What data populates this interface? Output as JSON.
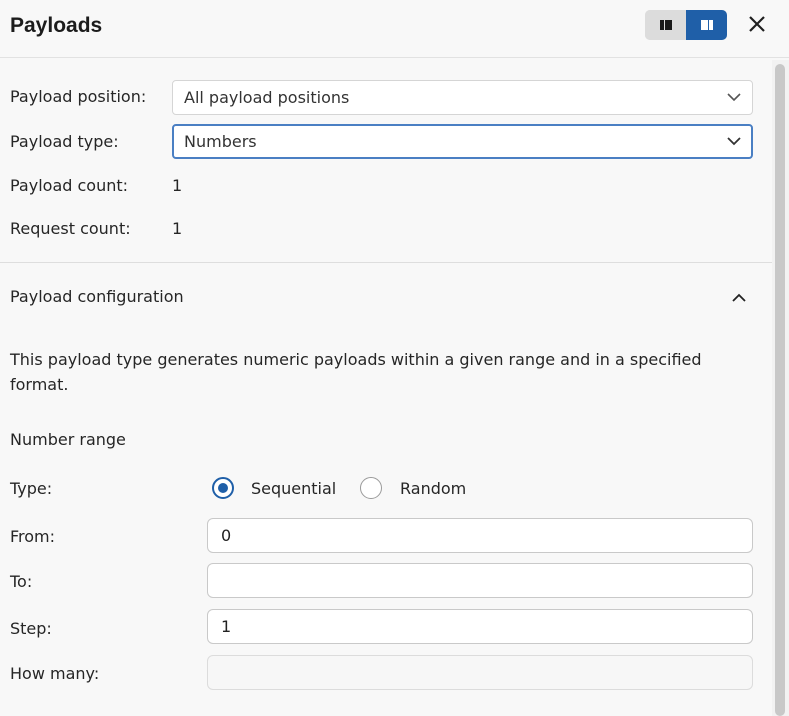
{
  "header": {
    "title": "Payloads",
    "layout_left_icon": "layout-compact-icon",
    "layout_right_icon": "layout-split-icon",
    "close_icon": "close-icon"
  },
  "settings": {
    "payload_position_label": "Payload position:",
    "payload_position_value": "All payload positions",
    "payload_type_label": "Payload type:",
    "payload_type_value": "Numbers",
    "payload_count_label": "Payload count:",
    "payload_count_value": "1",
    "request_count_label": "Request count:",
    "request_count_value": "1"
  },
  "config": {
    "section_title": "Payload configuration",
    "description": "This payload type generates numeric payloads within a given range and in a specified format.",
    "number_range_heading": "Number range",
    "type_label": "Type:",
    "option_sequential": "Sequential",
    "option_random": "Random",
    "selected_option": "Sequential",
    "from_label": "From:",
    "from_value": "0",
    "to_label": "To:",
    "to_value": "",
    "step_label": "Step:",
    "step_value": "1",
    "how_many_label": "How many:",
    "how_many_value": ""
  },
  "colors": {
    "accent": "#1f5fa8",
    "focus_border": "#4a7fc3",
    "background": "#f8f8f8"
  }
}
